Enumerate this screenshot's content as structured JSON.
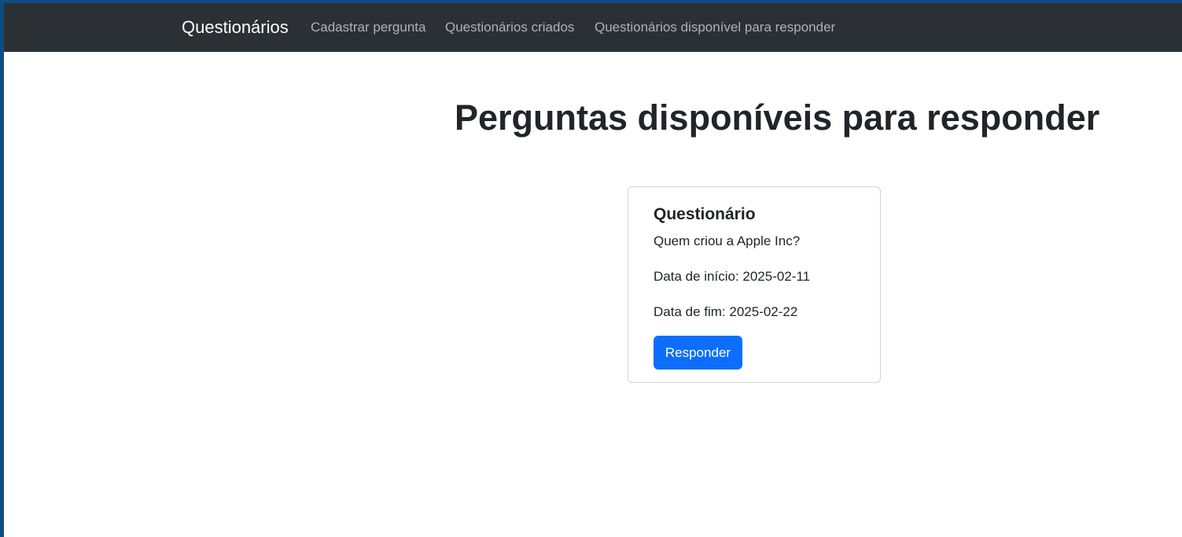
{
  "navbar": {
    "brand": "Questionários",
    "links": [
      {
        "label": "Cadastrar pergunta"
      },
      {
        "label": "Questionários criados"
      },
      {
        "label": "Questionários disponível para responder"
      }
    ]
  },
  "main": {
    "title": "Perguntas disponíveis para responder",
    "card": {
      "title": "Questionário",
      "question": "Quem criou a Apple Inc?",
      "start_date": "Data de início: 2025-02-11",
      "end_date": "Data de fim: 2025-02-22",
      "button_label": "Responder"
    }
  },
  "colors": {
    "navbar_bg": "#2b3035",
    "primary": "#0d6efd",
    "text": "#212529",
    "desktop_bg": "#0f4c81"
  }
}
